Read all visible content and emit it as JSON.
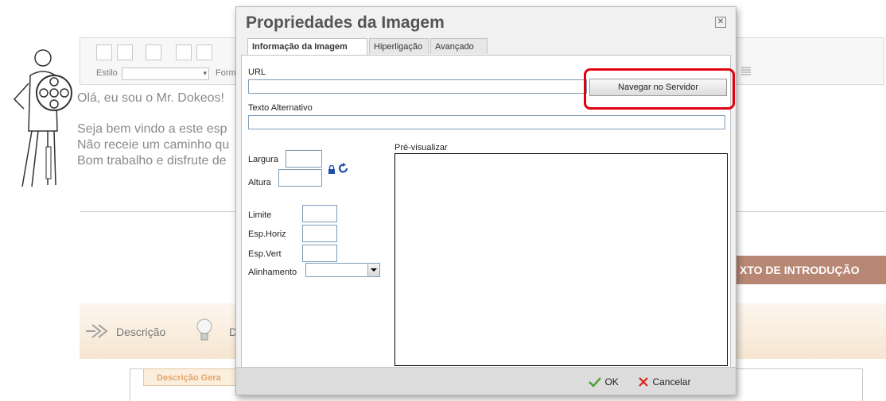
{
  "background": {
    "toolbar": {
      "style_label": "Estilo",
      "format_label": "Form"
    },
    "editor_lines": [
      "Olá, eu sou o Mr. Dokeos!",
      "Seja bem vindo a este esp",
      "Não receie um caminho qu",
      "Bom trabalho e disfrute de"
    ],
    "intro_button": "XTO DE INTRODUÇÃO",
    "section_label": "Descrição",
    "section_label_2": "D",
    "bottom_tab": "Descrição Gera"
  },
  "dialog": {
    "title": "Propriedades da Imagem",
    "tabs": [
      {
        "label": "Informação da Imagem",
        "active": true
      },
      {
        "label": "Hiperligação",
        "active": false
      },
      {
        "label": "Avançado",
        "active": false
      }
    ],
    "url_label": "URL",
    "url_value": "",
    "browse_button": "Navegar no Servidor",
    "alt_label": "Texto Alternativo",
    "alt_value": "",
    "width_label": "Largura",
    "height_label": "Altura",
    "border_label": "Limite",
    "hspace_label": "Esp.Horiz",
    "vspace_label": "Esp.Vert",
    "align_label": "Alinhamento",
    "align_value": "",
    "preview_label": "Pré-visualizar",
    "ok_label": "OK",
    "cancel_label": "Cancelar"
  },
  "colors": {
    "highlight": "#e1000f",
    "intro_button": "#b78773",
    "ok_check": "#4aa02c",
    "cancel_x": "#d8231b"
  }
}
